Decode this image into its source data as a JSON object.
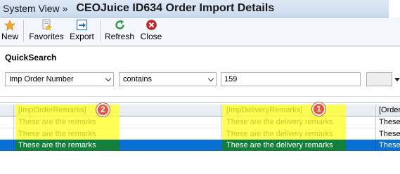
{
  "window": {
    "breadcrumb": "System View »",
    "title": "CEOJuice ID634 Order Import Details"
  },
  "toolbar": {
    "new_label": "New",
    "favorites_label": "Favorites",
    "export_label": "Export",
    "refresh_label": "Refresh",
    "close_label": "Close",
    "icons": {
      "new": "star-icon",
      "favorites": "favorites-icon",
      "export": "export-icon",
      "refresh": "refresh-icon",
      "close": "close-icon"
    }
  },
  "quicksearch": {
    "title": "QuickSearch",
    "field_value": "Imp Order Number",
    "operator_value": "contains",
    "search_value": "159"
  },
  "grid": {
    "columns": [
      "[ImpOrderRemarks]",
      "[ImpDeliveryRemarks]",
      "[Order"
    ],
    "rows": [
      [
        "These are the remarks",
        "These are the delivery remarks",
        "These"
      ],
      [
        "These are the remarks",
        "These are the delivery remarks",
        "These"
      ],
      [
        "These are the remarks",
        "These are the delivery remarks",
        "These"
      ]
    ],
    "selected_row": 2
  },
  "annotations": {
    "marker_1": "1",
    "marker_2": "2"
  },
  "colors": {
    "highlight": "#ffff28",
    "selection": "#0a6fd0",
    "marker": "#e8543a"
  }
}
